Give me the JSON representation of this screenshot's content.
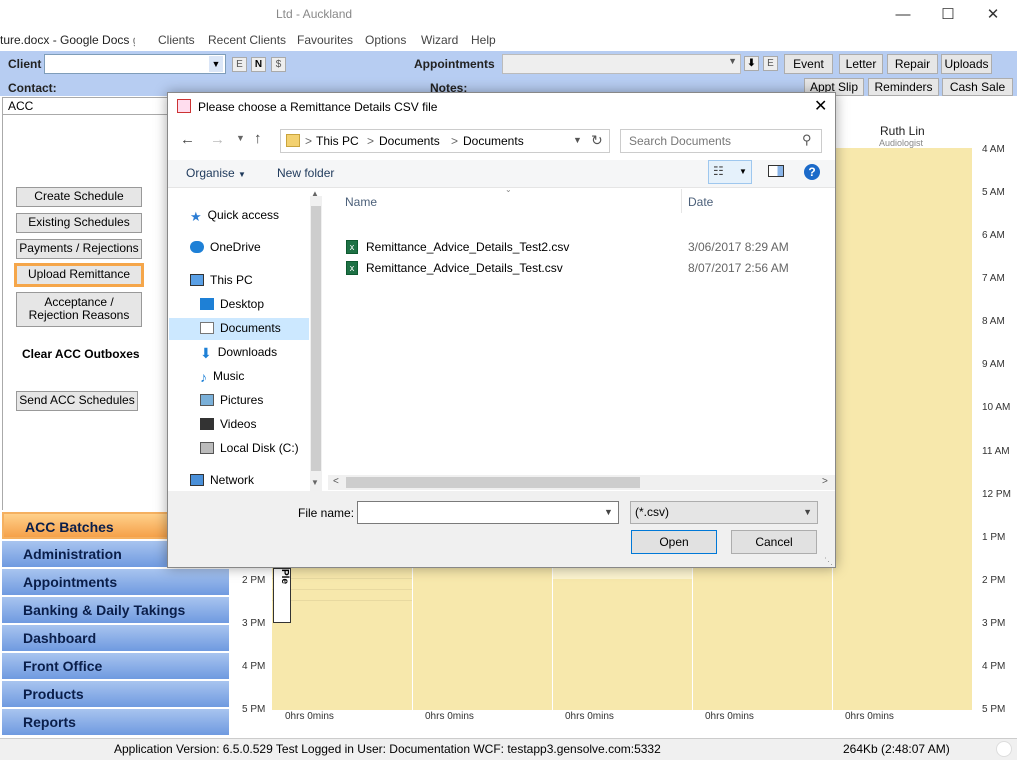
{
  "window": {
    "title": "Ltd - Auckland",
    "tab_text": "ture.docx - Google Docs",
    "tab_suffix": "g"
  },
  "menu": [
    "Clients",
    "Recent Clients",
    "Favourites",
    "Options",
    "Wizard",
    "Help"
  ],
  "client_bar": {
    "client_label": "Client",
    "contact_label": "Contact:",
    "small_buttons": [
      "E",
      "N",
      "$"
    ],
    "appointments_label": "Appointments",
    "appt_small_button": "E",
    "notes_label": "Notes:",
    "buttons_row1": [
      "Event",
      "Letter",
      "Repair",
      "Uploads"
    ],
    "buttons_row2": [
      "Appt Slip",
      "Reminders",
      "Cash Sale"
    ]
  },
  "left_panel": {
    "header": "ACC",
    "buttons": [
      "Create Schedule",
      "Existing Schedules",
      "Payments / Rejections",
      "Upload Remittance",
      "Acceptance /\nRejection Reasons"
    ],
    "clear_label": "Clear ACC Outboxes",
    "send_button": "Send ACC Schedules",
    "nav": [
      "ACC Batches",
      "Administration",
      "Appointments",
      "Banking & Daily Takings",
      "Dashboard",
      "Front Office",
      "Products",
      "Reports"
    ]
  },
  "schedule": {
    "staff_name": "Ruth Lin",
    "staff_role": "Audiologist",
    "times": [
      "4 AM",
      "5 AM",
      "6 AM",
      "7 AM",
      "8 AM",
      "9 AM",
      "10 AM",
      "11 AM",
      "12 PM",
      "1 PM",
      "2 PM",
      "3 PM",
      "4 PM",
      "5 PM"
    ],
    "left_times": [
      "2 PM",
      "3 PM",
      "4 PM",
      "5 PM"
    ],
    "hours_labels": [
      "0hrs 0mins",
      "0hrs 0mins",
      "0hrs 0mins",
      "0hrs 0mins",
      "0hrs 0mins"
    ],
    "appointment_text": "Ple"
  },
  "status_bar": {
    "left": "Application Version: 6.5.0.529 Test  Logged in User: Documentation WCF: testapp3.gensolve.com:5332",
    "right": "264Kb (2:48:07 AM)"
  },
  "dialog": {
    "title": "Please choose a Remittance Details CSV file",
    "breadcrumb": [
      "This PC",
      "Documents",
      "Documents"
    ],
    "search_placeholder": "Search Documents",
    "organise": "Organise",
    "new_folder": "New folder",
    "tree": [
      "Quick access",
      "OneDrive",
      "This PC",
      "Desktop",
      "Documents",
      "Downloads",
      "Music",
      "Pictures",
      "Videos",
      "Local Disk (C:)",
      "Network"
    ],
    "columns": {
      "name": "Name",
      "date": "Date"
    },
    "files": [
      {
        "name": "Remittance_Advice_Details_Test2.csv",
        "date": "3/06/2017 8:29 AM"
      },
      {
        "name": "Remittance_Advice_Details_Test.csv",
        "date": "8/07/2017 2:56 AM"
      }
    ],
    "file_name_label": "File name:",
    "file_name_value": "",
    "filter": "(*.csv)",
    "open_button": "Open",
    "cancel_button": "Cancel"
  }
}
